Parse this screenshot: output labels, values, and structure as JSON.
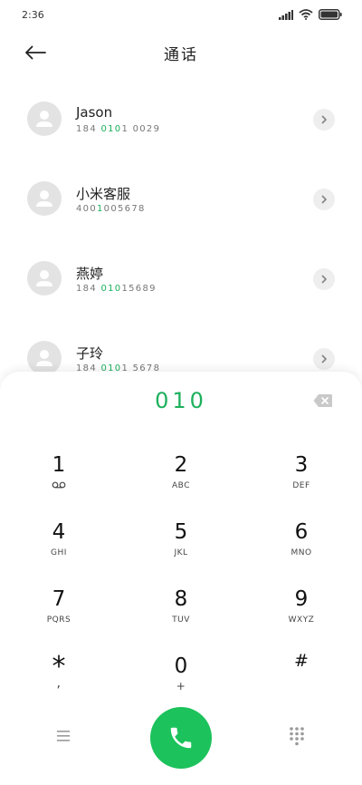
{
  "status_bar": {
    "time": "2:36"
  },
  "header": {
    "title": "通话"
  },
  "contacts": [
    {
      "name": "Jason",
      "number_parts": [
        "184 ",
        "010",
        "1 0029"
      ]
    },
    {
      "name": "小米客服",
      "number_parts": [
        "400",
        "1",
        "005678"
      ]
    },
    {
      "name": "燕婷",
      "number_parts": [
        "184 ",
        "010",
        "15689"
      ]
    },
    {
      "name": "子玲",
      "number_parts": [
        "184 ",
        "010",
        "1 5678"
      ]
    }
  ],
  "dialpad": {
    "input": "010",
    "keys": [
      {
        "digit": "1",
        "letters": "",
        "icon": "voicemail-icon"
      },
      {
        "digit": "2",
        "letters": "ABC"
      },
      {
        "digit": "3",
        "letters": "DEF"
      },
      {
        "digit": "4",
        "letters": "GHI"
      },
      {
        "digit": "5",
        "letters": "JKL"
      },
      {
        "digit": "6",
        "letters": "MNO"
      },
      {
        "digit": "7",
        "letters": "PQRS"
      },
      {
        "digit": "8",
        "letters": "TUV"
      },
      {
        "digit": "9",
        "letters": "WXYZ"
      },
      {
        "digit": "*",
        "letters": ","
      },
      {
        "digit": "0",
        "letters": "+"
      },
      {
        "digit": "#",
        "letters": ""
      }
    ]
  },
  "colors": {
    "accent": "#1db05c",
    "call_button": "#1cc25b",
    "avatar_bg": "#e3e3e3"
  }
}
